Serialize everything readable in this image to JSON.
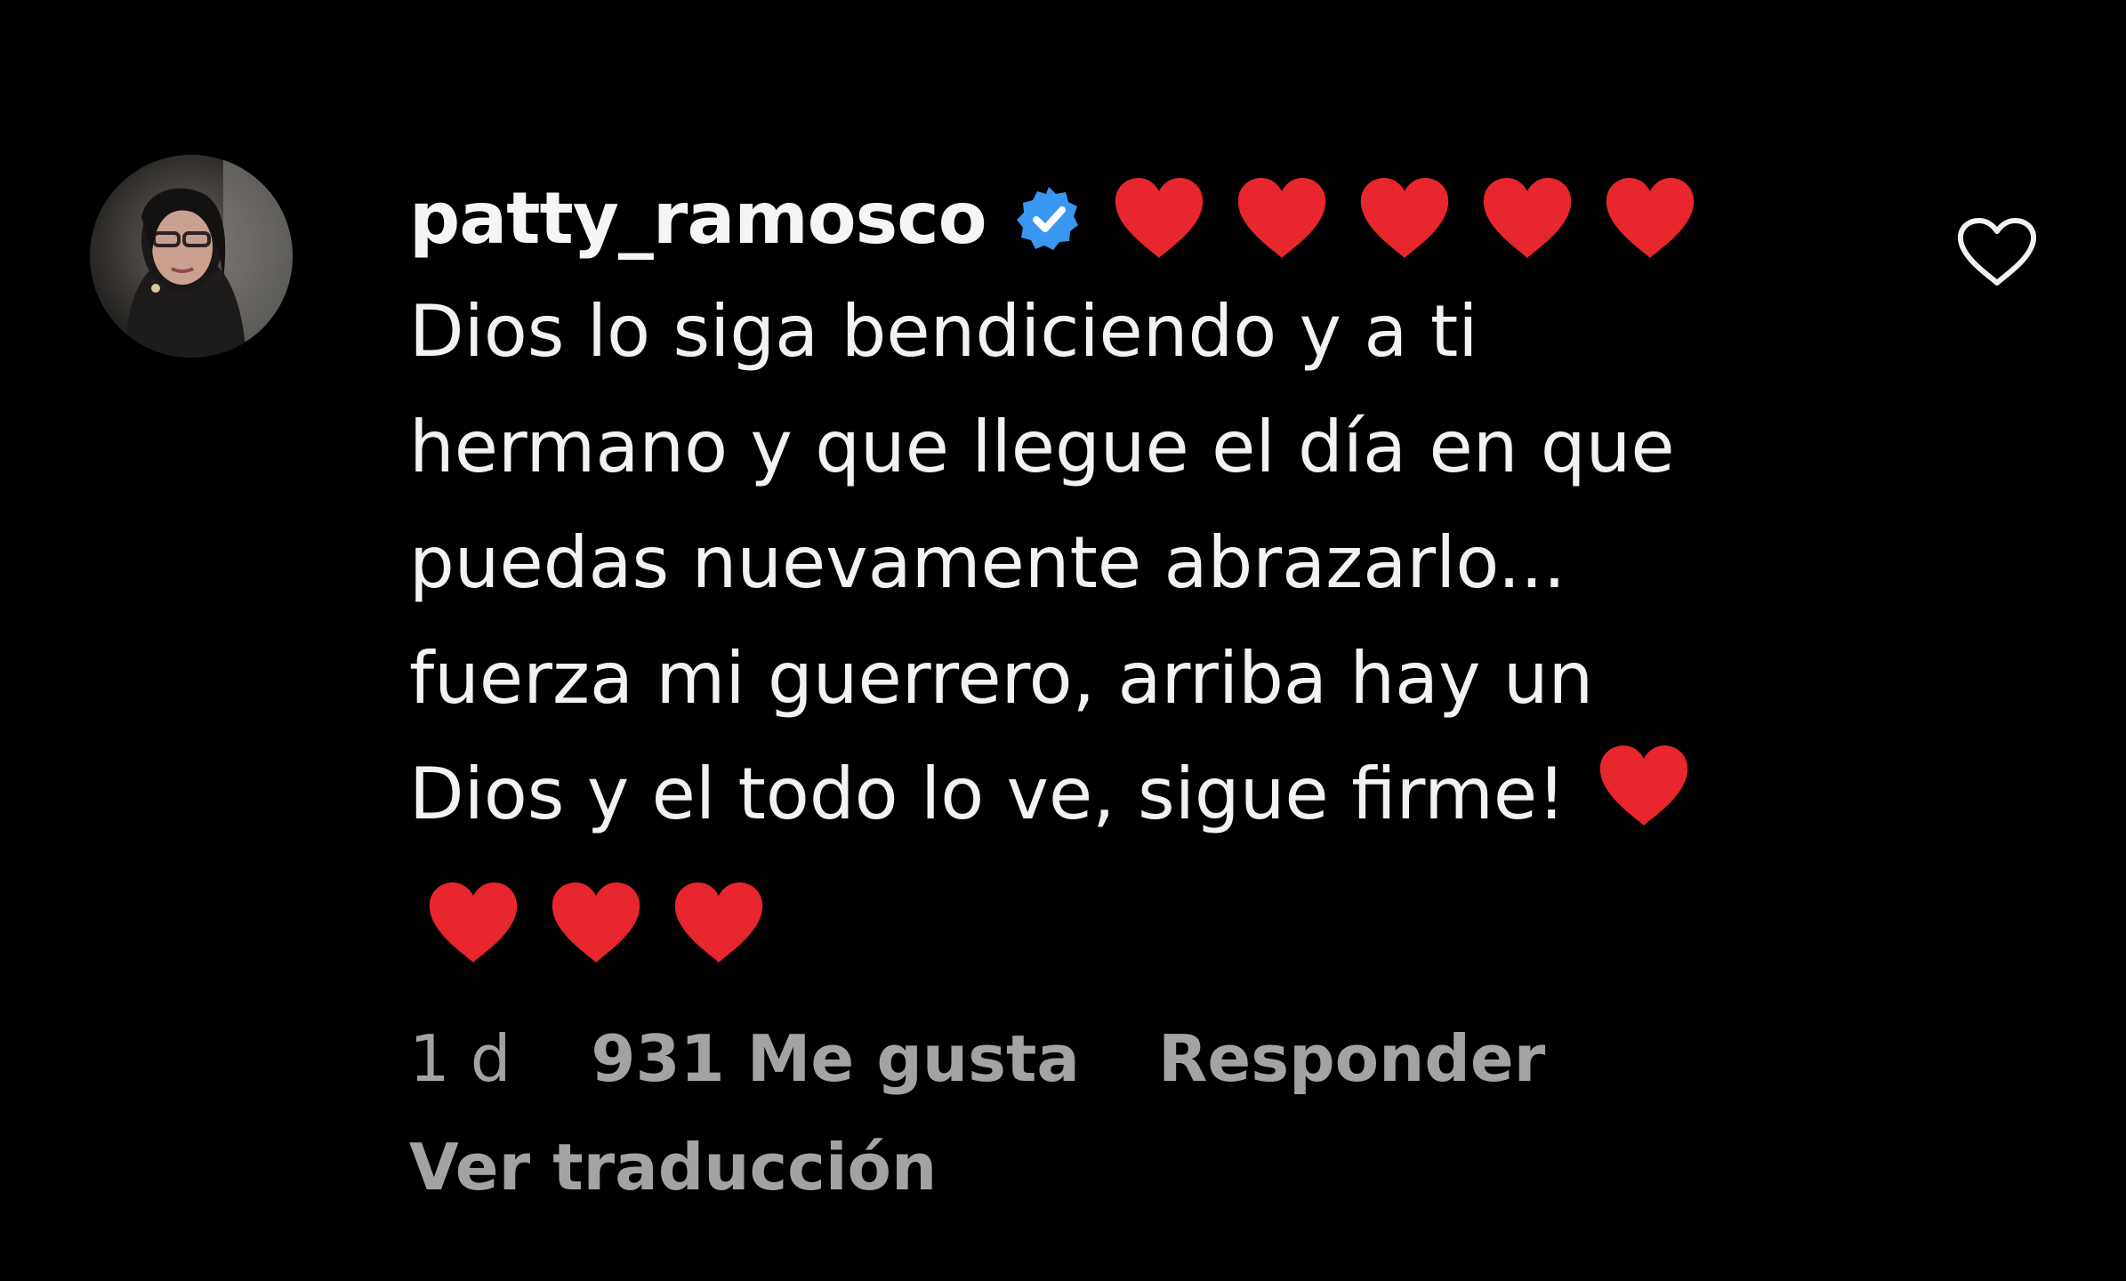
{
  "comment": {
    "username": "patty_ramosco",
    "verified": true,
    "header_emoji_count": 5,
    "lines": [
      "Dios lo siga bendiciendo y a ti",
      "hermano y que llegue el día en que",
      "puedas nuevamente abrazarlo...",
      "fuerza mi guerrero, arriba hay un",
      "Dios y el todo lo ve, sigue firme!"
    ],
    "trailing_emoji": "red-heart",
    "footer_emoji_count": 3
  },
  "meta": {
    "time": "1 d",
    "likes": "931 Me gusta",
    "reply": "Responder",
    "translate": "Ver traducción"
  },
  "colors": {
    "background": "#000000",
    "text": "#f2f2f2",
    "muted": "#a3a3a3",
    "heart": "#e8262d",
    "verified": "#3897f0"
  },
  "icons": {
    "verified": "verified-badge-icon",
    "emoji": "red-heart-icon",
    "like": "heart-outline-icon"
  }
}
